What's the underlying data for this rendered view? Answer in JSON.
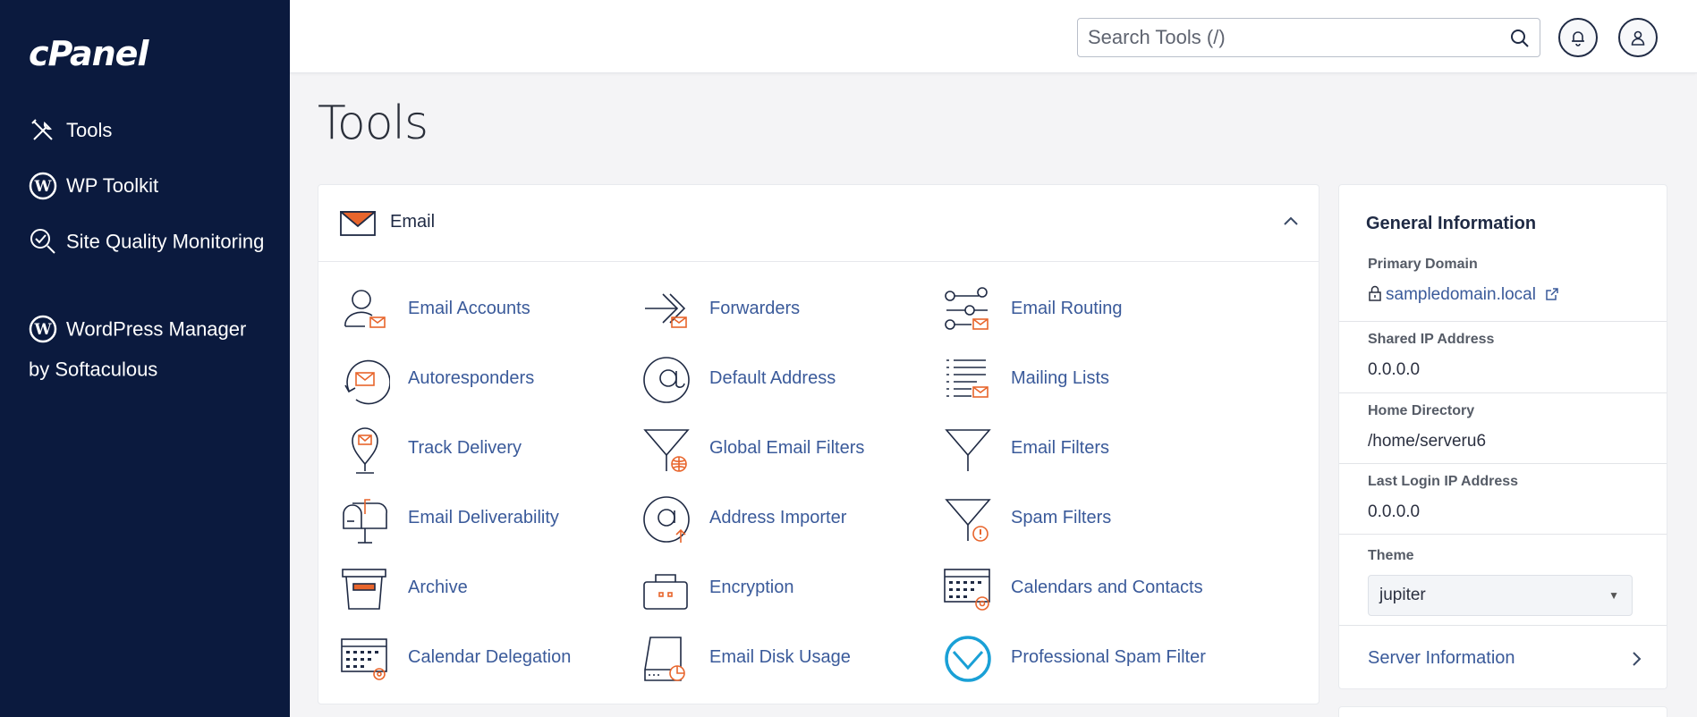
{
  "sidebar": {
    "logo": "cPanel",
    "items": [
      {
        "label": "Tools",
        "icon": "tools-icon"
      },
      {
        "label": "WP Toolkit",
        "icon": "wordpress-icon"
      },
      {
        "label": "Site Quality Monitoring",
        "icon": "site-quality-icon"
      },
      {
        "label": "WordPress Manager by Softaculous",
        "icon": "wordpress-icon"
      }
    ]
  },
  "topbar": {
    "search_placeholder": "Search Tools (/)",
    "icons": [
      "search-icon",
      "bell-icon",
      "user-icon"
    ]
  },
  "page": {
    "title": "Tools"
  },
  "email_section": {
    "title": "Email",
    "tools": [
      {
        "label": "Email Accounts",
        "icon": "email-accounts-icon"
      },
      {
        "label": "Forwarders",
        "icon": "forwarders-icon"
      },
      {
        "label": "Email Routing",
        "icon": "email-routing-icon"
      },
      {
        "label": "Autoresponders",
        "icon": "autoresponders-icon"
      },
      {
        "label": "Default Address",
        "icon": "default-address-icon"
      },
      {
        "label": "Mailing Lists",
        "icon": "mailing-lists-icon"
      },
      {
        "label": "Track Delivery",
        "icon": "track-delivery-icon"
      },
      {
        "label": "Global Email Filters",
        "icon": "global-email-filters-icon"
      },
      {
        "label": "Email Filters",
        "icon": "email-filters-icon"
      },
      {
        "label": "Email Deliverability",
        "icon": "email-deliverability-icon"
      },
      {
        "label": "Address Importer",
        "icon": "address-importer-icon"
      },
      {
        "label": "Spam Filters",
        "icon": "spam-filters-icon"
      },
      {
        "label": "Archive",
        "icon": "archive-icon"
      },
      {
        "label": "Encryption",
        "icon": "encryption-icon"
      },
      {
        "label": "Calendars and Contacts",
        "icon": "calendars-contacts-icon"
      },
      {
        "label": "Calendar Delegation",
        "icon": "calendar-delegation-icon"
      },
      {
        "label": "Email Disk Usage",
        "icon": "email-disk-usage-icon"
      },
      {
        "label": "Professional Spam Filter",
        "icon": "professional-spam-filter-icon"
      }
    ]
  },
  "general_info": {
    "title": "General Information",
    "primary_domain_label": "Primary Domain",
    "primary_domain": "sampledomain.local",
    "shared_ip_label": "Shared IP Address",
    "shared_ip": "0.0.0.0",
    "home_dir_label": "Home Directory",
    "home_dir": "/home/serveru6",
    "last_login_label": "Last Login IP Address",
    "last_login_ip": "0.0.0.0",
    "theme_label": "Theme",
    "theme_value": "jupiter",
    "server_info_label": "Server Information"
  },
  "colors": {
    "sidebar_bg": "#0b1a3e",
    "link": "#3a5a9a",
    "accent_orange": "#e8652c",
    "spam_filter_blue": "#1aa0d6"
  }
}
